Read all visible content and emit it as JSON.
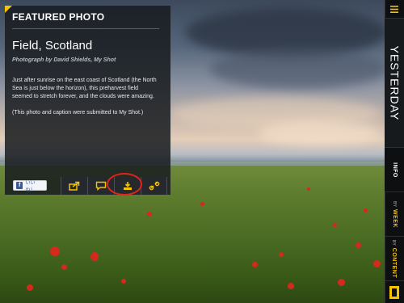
{
  "panel": {
    "eyebrow": "FEATURED PHOTO",
    "title": "Field, Scotland",
    "credit": "Photograph by David Shields, My Shot",
    "caption_1": "Just after sunrise on the east coast of Scotland (the North Sea is just below the horizon), this preharvest field seemed to stretch forever, and the clouds were amazing.",
    "caption_2": "(This photo and caption were submitted to My Shot.)"
  },
  "toolbar": {
    "like_icon_letter": "f",
    "like_label": "いいね！",
    "tools": [
      {
        "name": "share-icon"
      },
      {
        "name": "comment-icon"
      },
      {
        "name": "download-icon",
        "highlighted": true
      },
      {
        "name": "link-icon"
      }
    ]
  },
  "rail": {
    "yesterday_label": "YESTERDAY",
    "info_label": "INFO",
    "week_small": "BY",
    "week_big": "WEEK",
    "content_small": "BY",
    "content_big": "CONTENT"
  },
  "colors": {
    "accent": "#f5c400",
    "highlight_ring": "#e3231c",
    "facebook": "#3b5998"
  }
}
